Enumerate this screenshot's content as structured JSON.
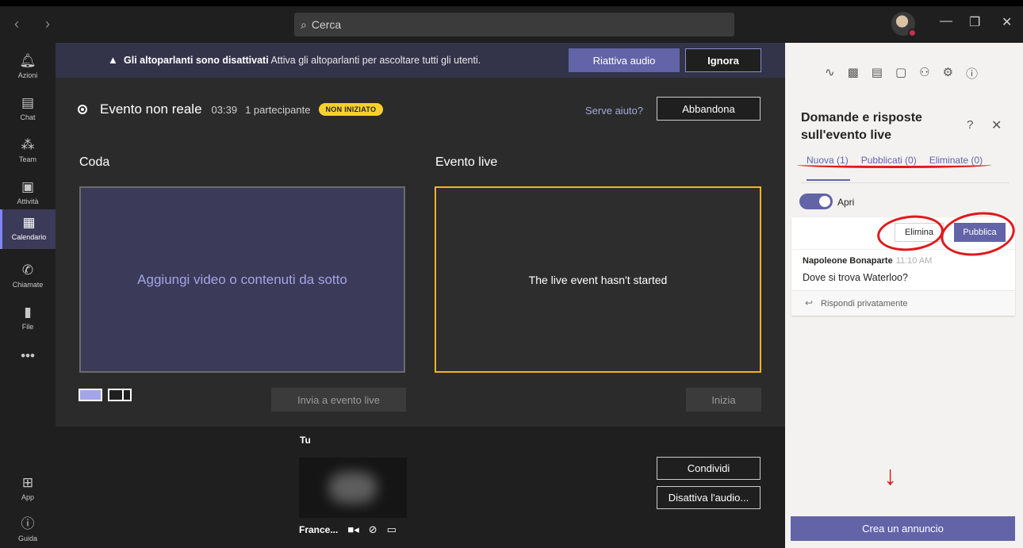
{
  "titlebar": {
    "search_placeholder": "Cerca"
  },
  "rail": {
    "items": [
      {
        "label": "Azioni",
        "icon": "bell-icon"
      },
      {
        "label": "Chat",
        "icon": "chat-icon"
      },
      {
        "label": "Team",
        "icon": "team-icon"
      },
      {
        "label": "Attività",
        "icon": "assignments-icon"
      },
      {
        "label": "Calendario",
        "icon": "calendar-icon"
      },
      {
        "label": "Chiamate",
        "icon": "phone-icon"
      },
      {
        "label": "File",
        "icon": "file-icon"
      },
      {
        "label": "App",
        "icon": "apps-icon"
      },
      {
        "label": "Guida",
        "icon": "help-icon"
      }
    ],
    "active": "Calendario",
    "more": "•••"
  },
  "banner": {
    "title": "Gli altoparlanti sono disattivati",
    "message": "Attiva gli altoparlanti per ascoltare tutti gli utenti.",
    "unmute_label": "Riattiva audio",
    "ignore_label": "Ignora"
  },
  "event": {
    "title": "Evento non reale",
    "timer": "03:39",
    "participants": "1 partecipante",
    "status_badge": "NON INIZIATO",
    "help_link": "Serve aiuto?",
    "leave_label": "Abbandona"
  },
  "queue": {
    "label": "Coda",
    "placeholder": "Aggiungi video o contenuti da sotto",
    "send_label": "Invia a evento live"
  },
  "live": {
    "label": "Evento live",
    "status": "The live event hasn't started",
    "start_label": "Inizia"
  },
  "bottom": {
    "you_label": "Tu",
    "user_name": "France...",
    "share_label": "Condividi",
    "mute_label": "Disattiva l'audio..."
  },
  "panel": {
    "title": "Domande e risposte sull'evento live",
    "tabs": [
      "Nuova (1)",
      "Pubblicati (0)",
      "Eliminate (0)"
    ],
    "toggle_label": "Apri",
    "delete_label": "Elimina",
    "publish_label": "Pubblica",
    "question": {
      "author": "Napoleone Bonaparte",
      "time": "11:10 AM",
      "text": "Dove si trova Waterloo?"
    },
    "reply_label": "Rispondi privatamente",
    "announce_label": "Crea un annuncio"
  },
  "colors": {
    "accent": "#6264a7",
    "badge": "#f8d22a",
    "live_border": "#f0b429",
    "annotation_red": "#e0191c"
  }
}
